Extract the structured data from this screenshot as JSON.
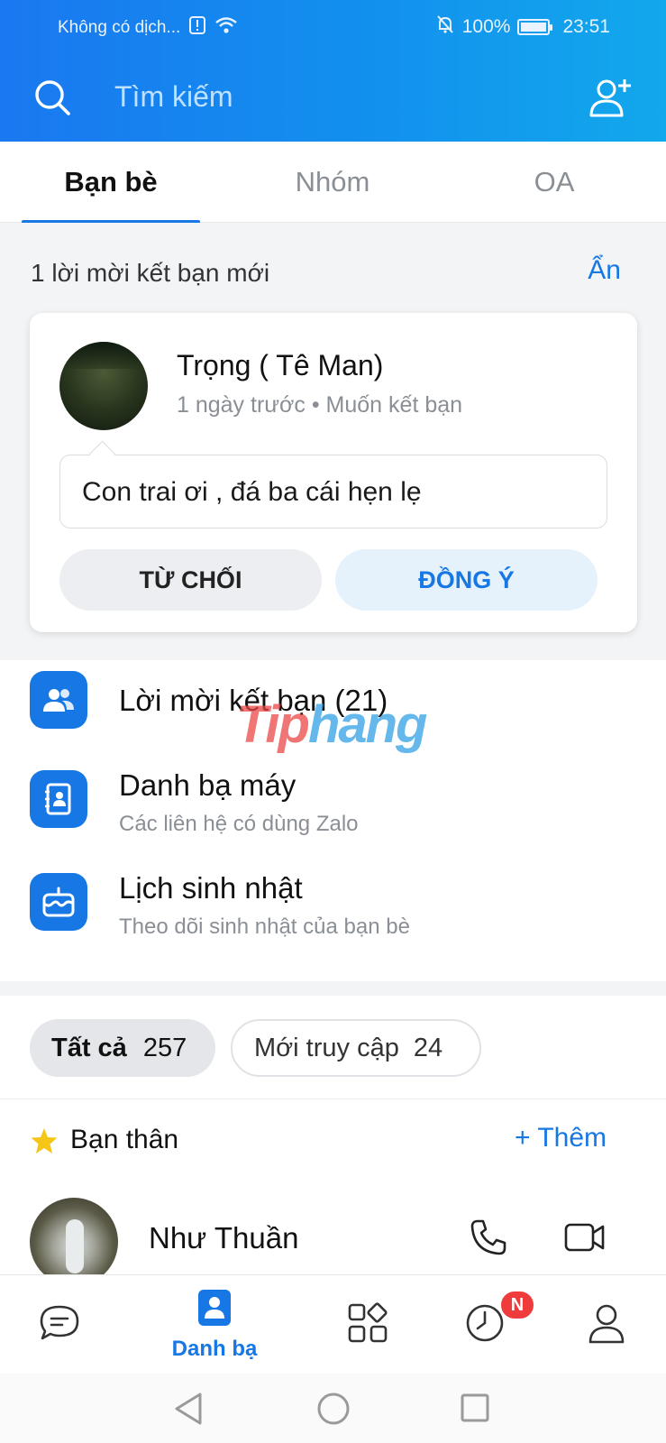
{
  "status_bar": {
    "carrier": "Không có dịch...",
    "battery": "100%",
    "time": "23:51"
  },
  "search": {
    "placeholder": "Tìm kiếm"
  },
  "tabs": [
    {
      "label": "Bạn bè"
    },
    {
      "label": "Nhóm"
    },
    {
      "label": "OA"
    }
  ],
  "invitations": {
    "heading": "1 lời mời kết bạn mới",
    "hide_label": "Ẩn",
    "card": {
      "name": "Trọng ( Tê Man)",
      "subtitle": "1 ngày trước • Muốn kết bạn",
      "message": "Con trai ơi , đá ba cái hẹn lẹ",
      "decline_label": "TỪ CHỐI",
      "accept_label": "ĐỒNG Ý"
    }
  },
  "menu": [
    {
      "title": "Lời mời kết bạn (21)",
      "subtitle": ""
    },
    {
      "title": "Danh bạ máy",
      "subtitle": "Các liên hệ có dùng Zalo"
    },
    {
      "title": "Lịch sinh nhật",
      "subtitle": "Theo dõi sinh nhật của bạn bè"
    }
  ],
  "filters": {
    "all": {
      "label": "Tất cả",
      "count": "257"
    },
    "recent": {
      "label": "Mới truy cập",
      "count": "24"
    }
  },
  "close_friends": {
    "title": "Bạn thân",
    "add_label": "+ Thêm"
  },
  "contacts": [
    {
      "name": "Như Thuần"
    }
  ],
  "bottom_nav": {
    "active_label": "Danh bạ",
    "badge": "N"
  },
  "watermark": {
    "part1": "Tip",
    "part2": "hang"
  },
  "colors": {
    "accent": "#1677e5",
    "header_start": "#1a78f0",
    "header_end": "#12a8ec",
    "badge": "#ef3b3b"
  }
}
